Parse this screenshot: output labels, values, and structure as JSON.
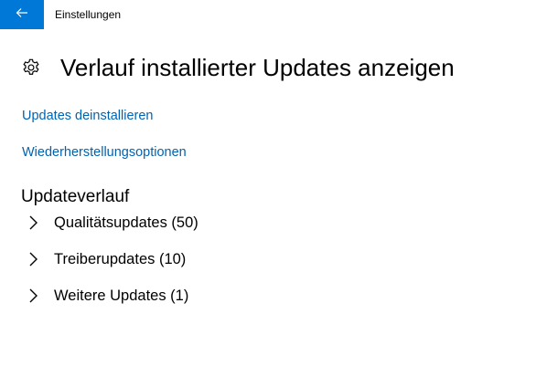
{
  "window": {
    "app_title": "Einstellungen",
    "back_icon": "back-arrow-icon",
    "accent_color": "#0078d7"
  },
  "header": {
    "icon": "gear-icon",
    "title": "Verlauf installierter Updates anzeigen"
  },
  "links": {
    "uninstall": "Updates deinstallieren",
    "recovery": "Wiederherstellungsoptionen",
    "link_color": "#0063b1"
  },
  "history": {
    "heading": "Updateverlauf",
    "groups": [
      {
        "label": "Qualitätsupdates (50)",
        "icon": "chevron-right-icon"
      },
      {
        "label": "Treiberupdates (10)",
        "icon": "chevron-right-icon"
      },
      {
        "label": "Weitere Updates (1)",
        "icon": "chevron-right-icon"
      }
    ]
  }
}
